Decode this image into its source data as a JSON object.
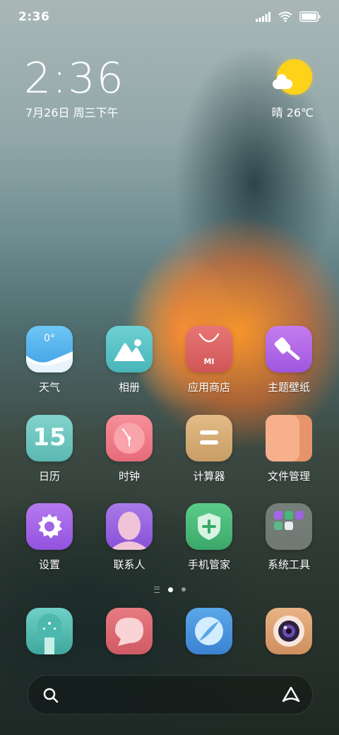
{
  "status_bar": {
    "time": "2:36"
  },
  "lockclock": {
    "time": "2:36",
    "date": "7月26日 周三下午"
  },
  "weather": {
    "summary": "晴 26℃"
  },
  "apps": [
    {
      "id": "weather",
      "label": "天气",
      "icon_text": "0°"
    },
    {
      "id": "gallery",
      "label": "相册"
    },
    {
      "id": "app-store",
      "label": "应用商店",
      "icon_text": "MI"
    },
    {
      "id": "themes",
      "label": "主题壁纸"
    },
    {
      "id": "calendar",
      "label": "日历",
      "icon_text": "15"
    },
    {
      "id": "clock",
      "label": "时钟"
    },
    {
      "id": "calculator",
      "label": "计算器"
    },
    {
      "id": "file-manager",
      "label": "文件管理"
    },
    {
      "id": "settings",
      "label": "设置"
    },
    {
      "id": "contacts",
      "label": "联系人"
    },
    {
      "id": "security",
      "label": "手机管家"
    },
    {
      "id": "system-tools",
      "label": "系统工具"
    }
  ],
  "page_indicator": {
    "pages": 2,
    "active": 0
  },
  "dock": [
    "phone",
    "messages",
    "browser",
    "camera"
  ],
  "colors": {
    "weather": "#5ab8ee",
    "gallery": "#5cc4c8",
    "app_store": "#e06666",
    "themes": "#b36ae6",
    "calendar": "#6ec7c0",
    "clock": "#ee7b86",
    "calculator": "#d9b079",
    "file_manager": "#f0a682",
    "settings": "#a466e8",
    "contacts": "#9b64e0",
    "security": "#46b87a",
    "sun": "#ffd21a"
  }
}
